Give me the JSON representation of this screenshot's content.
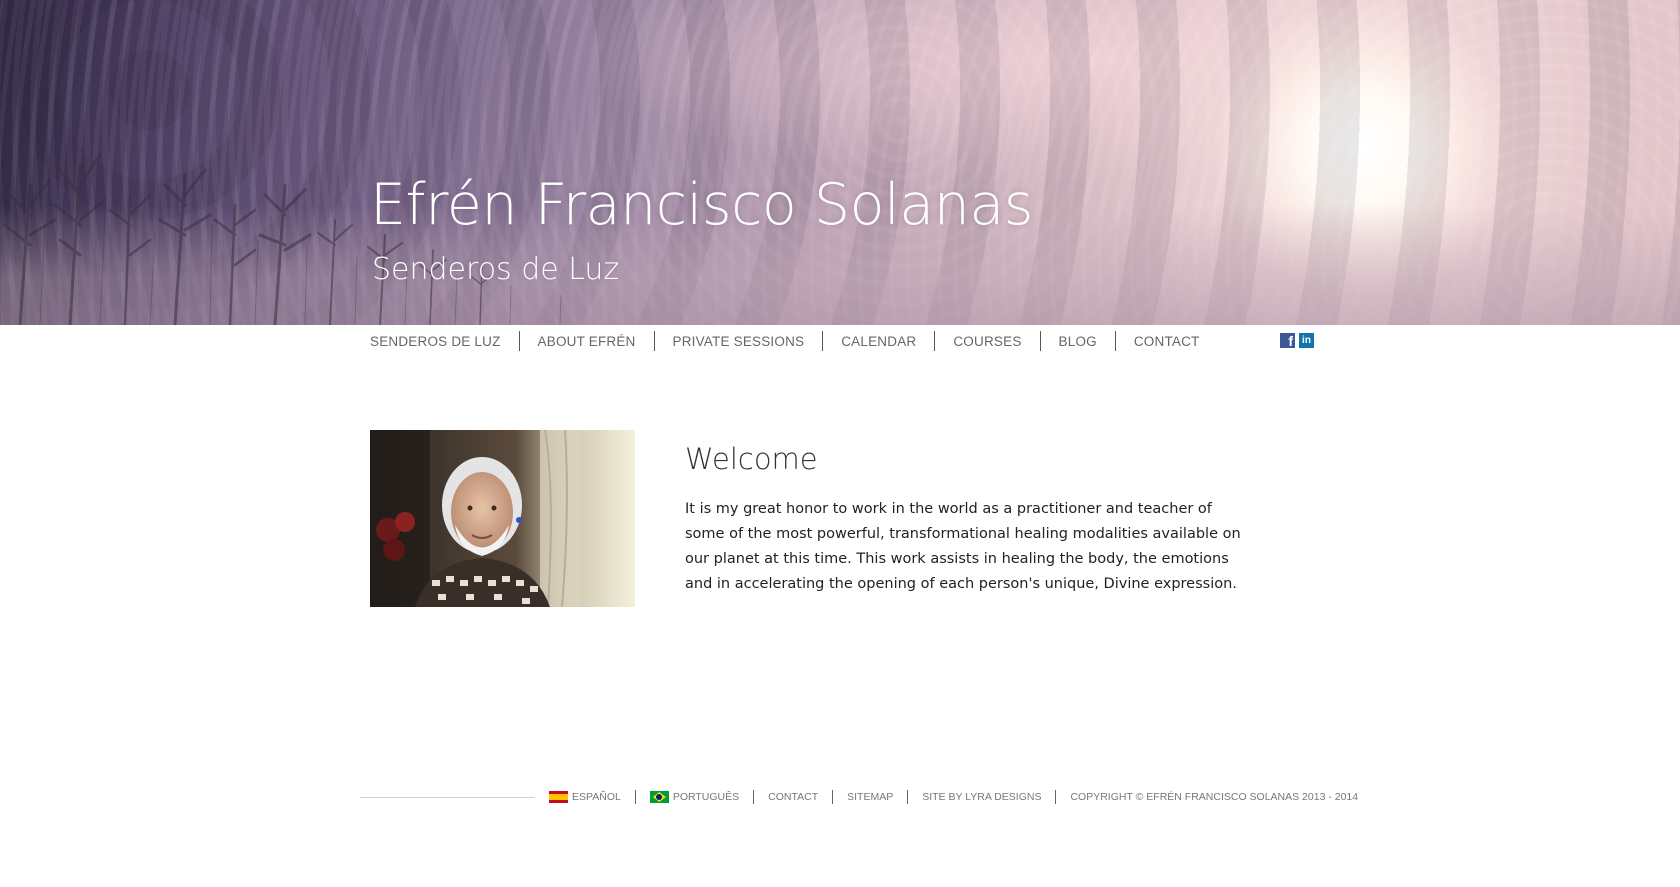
{
  "header": {
    "title": "Efrén Francisco Solanas",
    "subtitle": "Senderos de Luz"
  },
  "nav": {
    "items": [
      "SENDEROS DE LUZ",
      "ABOUT EFRÉN",
      "PRIVATE SESSIONS",
      "CALENDAR",
      "COURSES",
      "BLOG",
      "CONTACT"
    ]
  },
  "social": {
    "facebook_icon": "facebook-icon",
    "linkedin_icon": "linkedin-icon",
    "facebook_glyph": "f",
    "linkedin_glyph": "in"
  },
  "main": {
    "heading": "Welcome",
    "body": "It is my great honor to work in the world as a practitioner and teacher of some of the most powerful, transformational healing modalities available on our planet at this time. This work assists in healing the body, the emotions and in accelerating the opening of each person's unique, Divine expression."
  },
  "footer": {
    "language_es": "ESPAÑOL",
    "language_pt": "PORTUGUÊS",
    "contact": "CONTACT",
    "sitemap": "SITEMAP",
    "credit": "SITE BY LYRA DESIGNS",
    "copyright": "COPYRIGHT © EFRÉN FRANCISCO SOLANAS 2013 - 2014"
  },
  "colors": {
    "nav_text": "#666666",
    "footer_text": "#777777",
    "facebook": "#3b5998",
    "linkedin": "#0e76a8"
  }
}
